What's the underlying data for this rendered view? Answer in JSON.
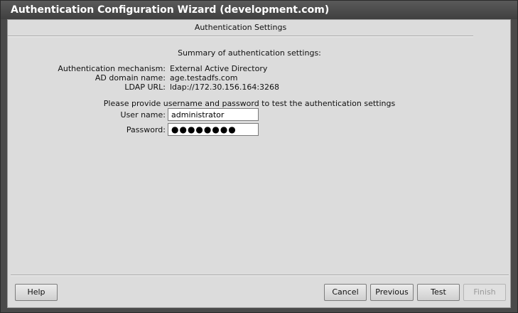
{
  "window": {
    "title": "Authentication Configuration Wizard (development.com)"
  },
  "page": {
    "section_title": "Authentication Settings",
    "summary_title": "Summary of authentication settings:",
    "summary": [
      {
        "label": "Authentication mechanism:",
        "value": "External Active Directory"
      },
      {
        "label": "AD domain name:",
        "value": "age.testadfs.com"
      },
      {
        "label": "LDAP URL:",
        "value": "ldap://172.30.156.164:3268"
      }
    ],
    "prompt": "Please provide username and password to test the authentication settings",
    "username": {
      "label": "User name:",
      "value": "administrator"
    },
    "password": {
      "label": "Password:",
      "value": "●●●●●●●●"
    }
  },
  "buttons": {
    "help": "Help",
    "cancel": "Cancel",
    "previous": "Previous",
    "test": "Test",
    "finish": "Finish"
  },
  "state": {
    "finish_enabled": false
  }
}
